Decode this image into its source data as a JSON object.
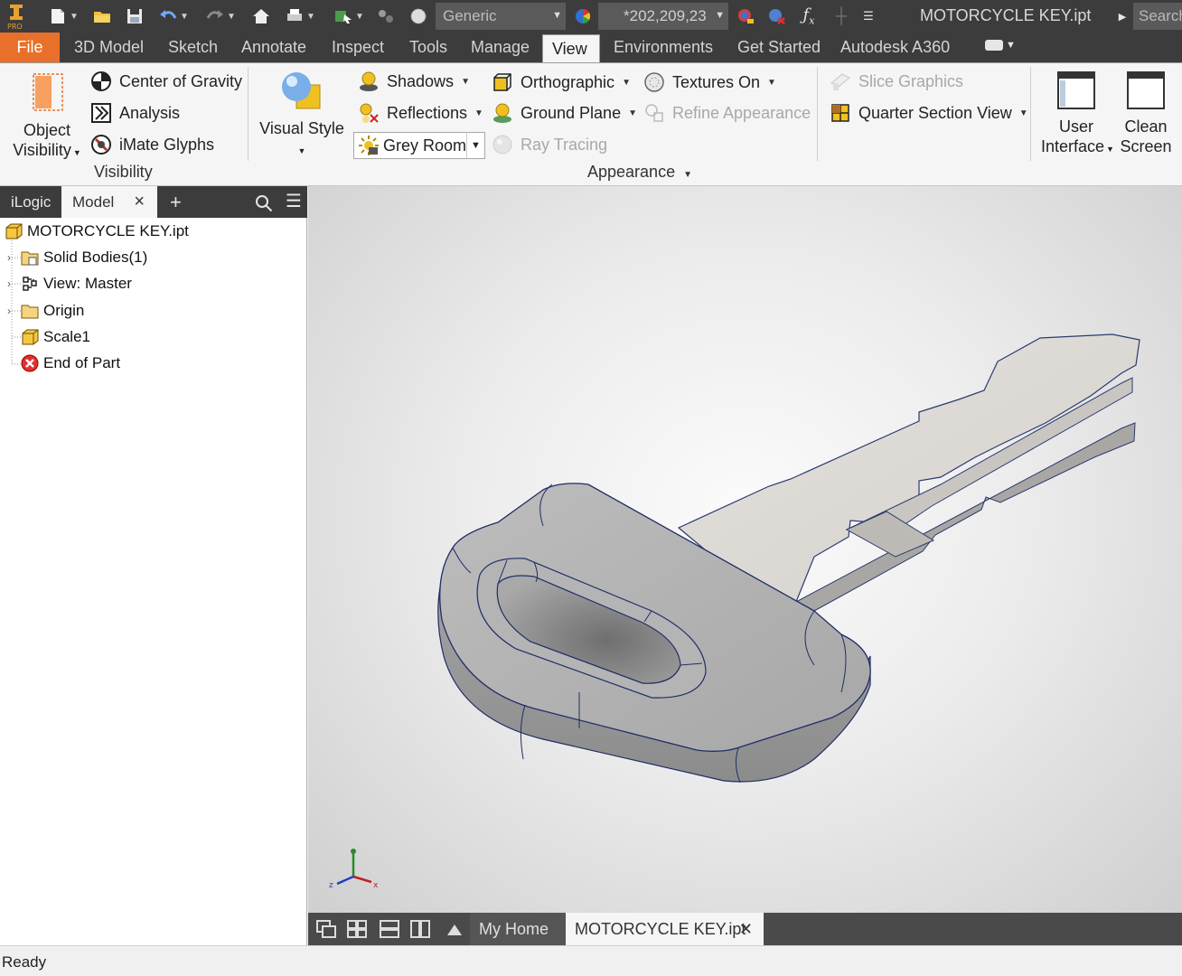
{
  "app": {
    "logo_label": "PRO",
    "document_title": "MOTORCYCLE KEY.ipt",
    "search_placeholder": "Search",
    "accent_color": "#e9702a"
  },
  "quick_access": {
    "material_value": "Generic",
    "appearance_value": "*202,209,23"
  },
  "ribbon_tabs": [
    {
      "label": "File"
    },
    {
      "label": "3D Model"
    },
    {
      "label": "Sketch"
    },
    {
      "label": "Annotate"
    },
    {
      "label": "Inspect"
    },
    {
      "label": "Tools"
    },
    {
      "label": "Manage"
    },
    {
      "label": "View",
      "active": true
    },
    {
      "label": "Environments"
    },
    {
      "label": "Get Started"
    },
    {
      "label": "Autodesk A360"
    }
  ],
  "ribbon": {
    "visibility": {
      "object_visibility_line1": "Object",
      "object_visibility_line2": "Visibility",
      "center_of_gravity": "Center of Gravity",
      "analysis": "Analysis",
      "imate_glyphs": "iMate Glyphs",
      "panel_label": "Visibility"
    },
    "appearance": {
      "visual_style": "Visual Style",
      "shadows": "Shadows",
      "reflections": "Reflections",
      "grey_room": "Grey Room",
      "orthographic": "Orthographic",
      "ground_plane": "Ground Plane",
      "ray_tracing": "Ray Tracing",
      "textures_on": "Textures On",
      "refine_appearance": "Refine Appearance",
      "panel_label": "Appearance"
    },
    "section": {
      "slice_graphics": "Slice Graphics",
      "quarter_section_view": "Quarter Section View"
    },
    "windows": {
      "user_interface_line1": "User",
      "user_interface_line2": "Interface",
      "clean_screen_line1": "Clean",
      "clean_screen_line2": "Screen"
    }
  },
  "browser": {
    "tabs": [
      {
        "label": "iLogic"
      },
      {
        "label": "Model",
        "active": true
      }
    ],
    "tree": [
      {
        "label": "MOTORCYCLE KEY.ipt",
        "icon": "part-icon"
      },
      {
        "label": "Solid Bodies(1)",
        "icon": "solid-bodies-icon"
      },
      {
        "label": "View: Master",
        "icon": "view-rep-icon"
      },
      {
        "label": "Origin",
        "icon": "folder-icon"
      },
      {
        "label": "Scale1",
        "icon": "scale-feature-icon"
      },
      {
        "label": "End of Part",
        "icon": "end-of-part-icon"
      }
    ]
  },
  "document_tabs": [
    {
      "label": "My Home"
    },
    {
      "label": "MOTORCYCLE KEY.ipt",
      "active": true
    }
  ],
  "status": {
    "text": "Ready"
  }
}
